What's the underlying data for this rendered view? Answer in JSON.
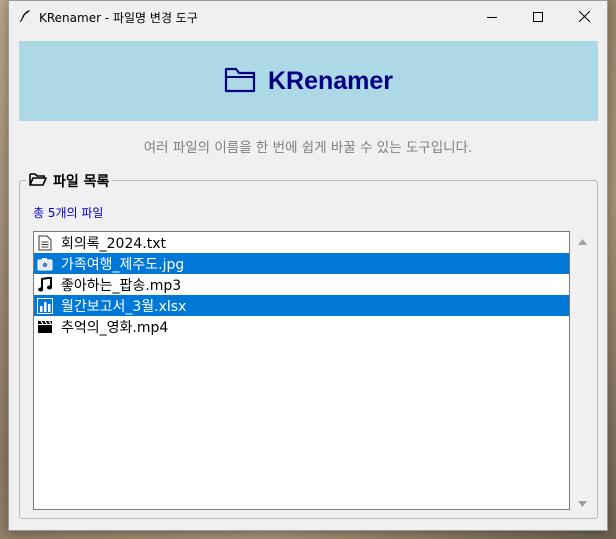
{
  "window": {
    "title": "KRenamer - 파일명 변경 도구",
    "title_icon": "feather-icon",
    "controls": [
      "minimize-icon",
      "maximize-icon",
      "close-icon"
    ]
  },
  "header": {
    "icon": "folder-icon",
    "title": "KRenamer",
    "background": "#add8e6",
    "title_color": "#000080"
  },
  "subtitle": "여러 파일의 이름을 한 번에 쉽게 바꿀 수 있는 도구입니다.",
  "file_group": {
    "icon": "open-folder-icon",
    "label": "파일 목록",
    "count_label": "총 5개의 파일",
    "files": [
      {
        "name": "회의록_2024.txt",
        "icon": "text-file-icon",
        "selected": false
      },
      {
        "name": "가족여행_제주도.jpg",
        "icon": "camera-icon",
        "selected": true
      },
      {
        "name": "좋아하는_팝송.mp3",
        "icon": "music-note-icon",
        "selected": false
      },
      {
        "name": "월간보고서_3월.xlsx",
        "icon": "bar-chart-icon",
        "selected": true
      },
      {
        "name": "추억의_영화.mp4",
        "icon": "clapperboard-icon",
        "selected": false
      }
    ]
  },
  "colors": {
    "selection": "#0078d7",
    "count_text": "#0000cc",
    "subtitle_text": "#808080"
  }
}
